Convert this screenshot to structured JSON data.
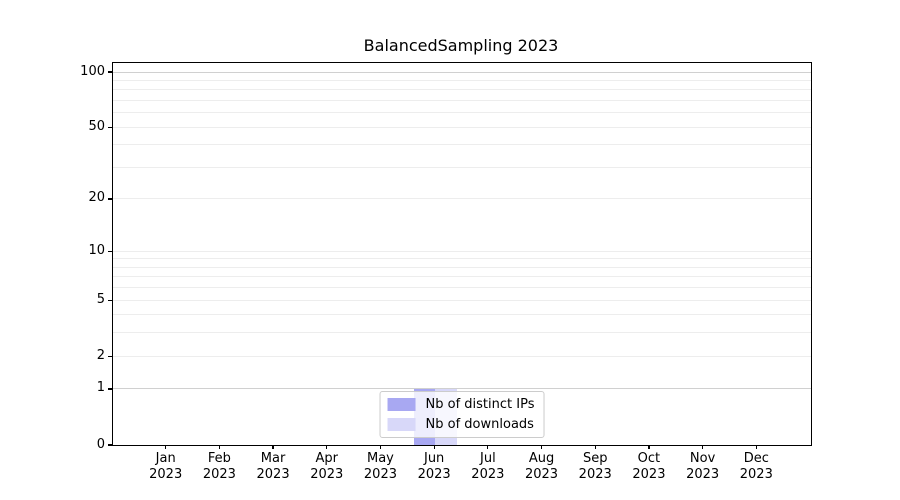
{
  "figure": {
    "title": "BalancedSampling 2023"
  },
  "chart_data": {
    "type": "bar",
    "title": "BalancedSampling 2023",
    "x_categories": [
      "Jan",
      "Feb",
      "Mar",
      "Apr",
      "May",
      "Jun",
      "Jul",
      "Aug",
      "Sep",
      "Oct",
      "Nov",
      "Dec"
    ],
    "x_year_label": "2023",
    "series": [
      {
        "name": "Nb of distinct IPs",
        "color": "#a8a8f2",
        "values": [
          0,
          0,
          0,
          0,
          0,
          1,
          0,
          0,
          0,
          0,
          0,
          0
        ]
      },
      {
        "name": "Nb of downloads",
        "color": "#d8d8f9",
        "values": [
          0,
          0,
          0,
          0,
          0,
          1,
          0,
          0,
          0,
          0,
          0,
          0
        ]
      }
    ],
    "y_axis": {
      "scale": "log1p",
      "tick_values": [
        100,
        50,
        20,
        10,
        5,
        2,
        1,
        0
      ],
      "max_value": 112
    },
    "grid": {
      "on": true,
      "major_values": [
        1,
        100
      ],
      "minor_values": [
        2,
        3,
        4,
        5,
        6,
        7,
        8,
        9,
        10,
        20,
        30,
        40,
        50,
        60,
        70,
        80,
        90
      ],
      "major_color": "#d0d0d0",
      "minor_color": "#ededed"
    },
    "legend": {
      "position": "lower center",
      "entries": [
        "Nb of distinct IPs",
        "Nb of downloads"
      ]
    },
    "bar_layout": {
      "width_fraction": 0.4,
      "offset_fraction": 0.2
    }
  }
}
